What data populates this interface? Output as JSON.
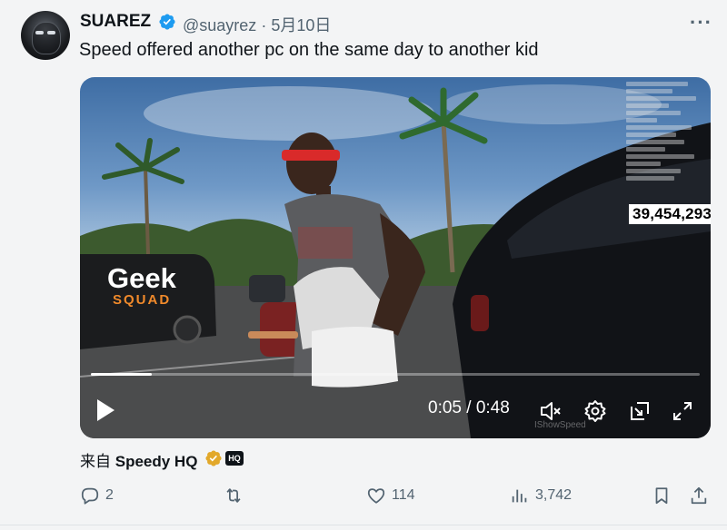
{
  "author": {
    "name": "SUAREZ",
    "handle": "@suayrez",
    "separator": "·",
    "date": "5月10日"
  },
  "tweet": {
    "text": "Speed offered another pc on the same day to another kid"
  },
  "video": {
    "counter": "39,454,293",
    "time": "0:05 / 0:48",
    "progress": 0.1,
    "watermark": "IShowSpeed",
    "logo_text_1": "Geek",
    "logo_text_2": "SQUAD"
  },
  "source": {
    "prefix": "来自",
    "name": "Speedy HQ",
    "badge": "HQ"
  },
  "actions": {
    "replies": "2",
    "likes": "114",
    "views": "3,742"
  },
  "colors": {
    "verified_blue": "#1d9bf0",
    "gold_badge": "#e2a82a",
    "muted_text": "#536471"
  },
  "icons": [
    "verified-icon",
    "more-icon",
    "play-icon",
    "mute-icon",
    "settings-icon",
    "pip-icon",
    "fullscreen-icon",
    "gold-verified-icon",
    "reply-icon",
    "retweet-icon",
    "like-icon",
    "views-icon",
    "bookmark-icon",
    "share-icon"
  ]
}
